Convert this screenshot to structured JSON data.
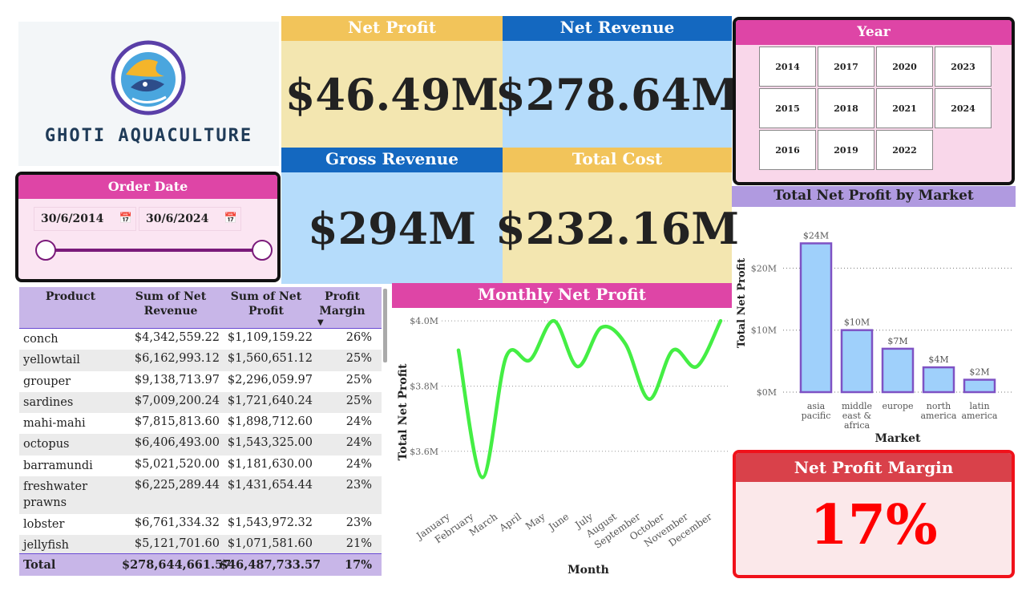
{
  "logo": {
    "text": "GHOTI AQUACULTURE",
    "icon": "fish-logo-icon"
  },
  "kpis": {
    "net_profit": {
      "label": "Net Profit",
      "value": "$46.49M"
    },
    "net_revenue": {
      "label": "Net Revenue",
      "value": "$278.64M"
    },
    "gross_revenue": {
      "label": "Gross Revenue",
      "value": "$294M"
    },
    "total_cost": {
      "label": "Total Cost",
      "value": "$232.16M"
    }
  },
  "year_slicer": {
    "title": "Year",
    "years": [
      "2014",
      "2017",
      "2020",
      "2023",
      "2015",
      "2018",
      "2021",
      "2024",
      "2016",
      "2019",
      "2022"
    ]
  },
  "order_date": {
    "title": "Order Date",
    "start": "30/6/2014",
    "end": "30/6/2024",
    "calendar_icon": "calendar-icon"
  },
  "table": {
    "headers": [
      "Product",
      "Sum of Net Revenue",
      "Sum of Net Profit",
      "Profit Margin"
    ],
    "rows": [
      [
        "conch",
        "$4,342,559.22",
        "$1,109,159.22",
        "26%"
      ],
      [
        "yellowtail",
        "$6,162,993.12",
        "$1,560,651.12",
        "25%"
      ],
      [
        "grouper",
        "$9,138,713.97",
        "$2,296,059.97",
        "25%"
      ],
      [
        "sardines",
        "$7,009,200.24",
        "$1,721,640.24",
        "25%"
      ],
      [
        "mahi-mahi",
        "$7,815,813.60",
        "$1,898,712.60",
        "24%"
      ],
      [
        "octopus",
        "$6,406,493.00",
        "$1,543,325.00",
        "24%"
      ],
      [
        "barramundi",
        "$5,021,520.00",
        "$1,181,630.00",
        "24%"
      ],
      [
        "freshwater prawns",
        "$6,225,289.44",
        "$1,431,654.44",
        "23%"
      ],
      [
        "lobster",
        "$6,761,334.32",
        "$1,543,972.32",
        "23%"
      ],
      [
        "jellyfish",
        "$5,121,701.60",
        "$1,071,581.60",
        "21%"
      ]
    ],
    "total": [
      "Total",
      "$278,644,661.57",
      "$46,487,733.57",
      "17%"
    ]
  },
  "net_profit_margin": {
    "label": "Net Profit Margin",
    "value": "17%"
  },
  "chart_data": [
    {
      "type": "line",
      "title": "Monthly Net Profit",
      "xlabel": "Month",
      "ylabel": "Total Net Profit",
      "categories": [
        "January",
        "February",
        "March",
        "April",
        "May",
        "June",
        "July",
        "August",
        "September",
        "October",
        "November",
        "December"
      ],
      "values": [
        3.91,
        3.52,
        3.89,
        3.88,
        4.0,
        3.86,
        3.98,
        3.93,
        3.76,
        3.91,
        3.86,
        4.0
      ],
      "yticks": [
        "$3.6M",
        "$3.8M",
        "$4.0M"
      ],
      "ylim": [
        3.42,
        4.02
      ],
      "unit": "M",
      "color": "#44ee44"
    },
    {
      "type": "bar",
      "title": "Total Net Profit by Market",
      "xlabel": "Market",
      "ylabel": "Total Net Profit",
      "categories": [
        "asia pacific",
        "middle east & africa",
        "europe",
        "north america",
        "latin america"
      ],
      "category_lines": [
        [
          "asia",
          "pacific"
        ],
        [
          "middle",
          "east &",
          "africa"
        ],
        [
          "europe"
        ],
        [
          "north",
          "america"
        ],
        [
          "latin",
          "america"
        ]
      ],
      "values": [
        24,
        10,
        7,
        4,
        2
      ],
      "data_labels": [
        "$24M",
        "$10M",
        "$7M",
        "$4M",
        "$2M"
      ],
      "yticks": [
        "$0M",
        "$10M",
        "$20M"
      ],
      "ylim": [
        0,
        26
      ],
      "bar_color": "#9fd0fb",
      "bar_border": "#7e52c4"
    }
  ]
}
